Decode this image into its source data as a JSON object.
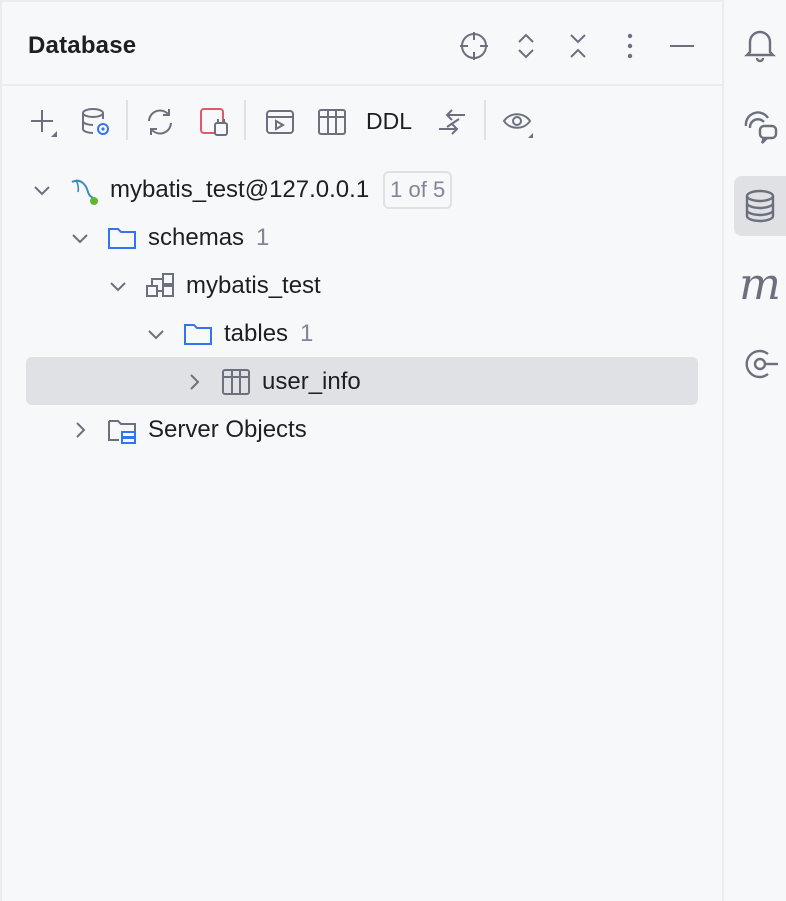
{
  "panel": {
    "title": "Database"
  },
  "toolbar": {
    "ddl_label": "DDL"
  },
  "tree": {
    "connection": {
      "label": "mybatis_test@127.0.0.1",
      "badge": "1 of 5"
    },
    "schemas": {
      "label": "schemas",
      "count": "1"
    },
    "schema": {
      "label": "mybatis_test"
    },
    "tables": {
      "label": "tables",
      "count": "1"
    },
    "table": {
      "label": "user_info"
    },
    "server_objects": {
      "label": "Server Objects"
    }
  },
  "colors": {
    "background": "#f7f8fa",
    "selection": "#dfe1e5",
    "folder_blue": "#3574f0",
    "muted_text": "#818594",
    "icon_gray": "#6c707e",
    "connection_green": "#5fb832",
    "stop_red": "#e55765"
  },
  "icons": {
    "header": [
      "locate-icon",
      "expand-all-icon",
      "collapse-all-icon",
      "more-icon",
      "minimize-icon"
    ],
    "toolbar": [
      "add-icon",
      "data-source-properties-icon",
      "refresh-icon",
      "disconnect-icon",
      "open-console-icon",
      "table-view-icon",
      "compare-icon",
      "view-options-icon"
    ],
    "right_toolbar": [
      "notifications-icon",
      "ai-assistant-icon",
      "database-icon",
      "maven-icon",
      "endpoints-icon"
    ]
  }
}
